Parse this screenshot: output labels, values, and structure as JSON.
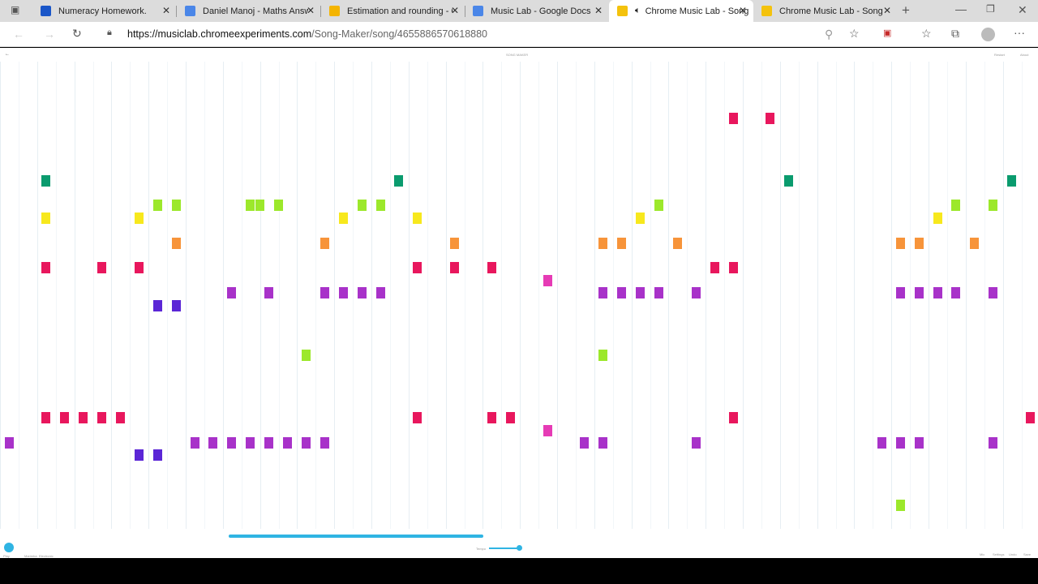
{
  "browser": {
    "tabs": [
      {
        "label": "Numeracy Homework.",
        "color": "#1a56c8"
      },
      {
        "label": "Daniel Manoj - Maths Answ",
        "color": "#4a86e8"
      },
      {
        "label": "Estimation and rounding - G",
        "color": "#f4b400"
      },
      {
        "label": "Music Lab - Google Docs",
        "color": "#4a86e8"
      },
      {
        "label": "Chrome Music Lab - Song Maker",
        "color": "#f4c20d",
        "active": true,
        "audio": true
      },
      {
        "label": "Chrome Music Lab - Song Maker",
        "color": "#f4c20d"
      }
    ],
    "url_domain": "https://musiclab.chromeexperiments.com",
    "url_path": "/Song-Maker/song/4655886570618880"
  },
  "app": {
    "title": "SONG MAKER",
    "top_right": [
      "Restart",
      "About"
    ],
    "bottom_left": [
      "Play",
      "Marimba",
      "Electronic"
    ],
    "tempo_label": "Tempo",
    "tempo_level": 0.9,
    "playback_progress": 0.25,
    "bottom_right": [
      "Mic",
      "Settings",
      "Undo",
      "Save"
    ],
    "accent": "#2fb4e3"
  },
  "song": {
    "row_colors": {
      "4": "#e8175d",
      "9": "#0a9b6e",
      "11": "#9ce82b",
      "12": "#f7e81d",
      "14": "#f7943a",
      "16": "#e8175d",
      "17": "#e63bb5",
      "18": "#a832c9",
      "19": "#5b26d6",
      "23": "#9ce82b",
      "28": "#e8175d",
      "29": "#e63bb5",
      "30": "#a832c9",
      "31": "#5b26d6",
      "35": "#9ce82b"
    },
    "notes": [
      [
        39,
        4
      ],
      [
        41,
        4
      ],
      [
        2,
        9
      ],
      [
        21,
        9
      ],
      [
        42,
        9
      ],
      [
        54,
        9
      ],
      [
        8,
        11
      ],
      [
        9,
        11
      ],
      [
        13,
        11
      ],
      [
        13.5,
        11
      ],
      [
        14.5,
        11
      ],
      [
        19,
        11
      ],
      [
        20,
        11
      ],
      [
        35,
        11
      ],
      [
        51,
        11
      ],
      [
        53,
        11
      ],
      [
        2,
        12
      ],
      [
        7,
        12
      ],
      [
        18,
        12
      ],
      [
        22,
        12
      ],
      [
        34,
        12
      ],
      [
        50,
        12
      ],
      [
        9,
        14
      ],
      [
        17,
        14
      ],
      [
        24,
        14
      ],
      [
        32,
        14
      ],
      [
        33,
        14
      ],
      [
        36,
        14
      ],
      [
        48,
        14
      ],
      [
        49,
        14
      ],
      [
        52,
        14
      ],
      [
        2,
        16
      ],
      [
        5,
        16
      ],
      [
        7,
        16
      ],
      [
        22,
        16
      ],
      [
        24,
        16
      ],
      [
        26,
        16
      ],
      [
        38,
        16
      ],
      [
        39,
        16
      ],
      [
        29,
        17
      ],
      [
        12,
        18
      ],
      [
        14,
        18
      ],
      [
        17,
        18
      ],
      [
        18,
        18
      ],
      [
        19,
        18
      ],
      [
        20,
        18
      ],
      [
        32,
        18
      ],
      [
        33,
        18
      ],
      [
        34,
        18
      ],
      [
        35,
        18
      ],
      [
        37,
        18
      ],
      [
        48,
        18
      ],
      [
        49,
        18
      ],
      [
        50,
        18
      ],
      [
        51,
        18
      ],
      [
        53,
        18
      ],
      [
        8,
        19
      ],
      [
        9,
        19
      ],
      [
        16,
        23
      ],
      [
        32,
        23
      ],
      [
        2,
        28
      ],
      [
        3,
        28
      ],
      [
        4,
        28
      ],
      [
        5,
        28
      ],
      [
        6,
        28
      ],
      [
        22,
        28
      ],
      [
        26,
        28
      ],
      [
        27,
        28
      ],
      [
        39,
        28
      ],
      [
        55,
        28
      ],
      [
        29,
        29
      ],
      [
        0,
        30
      ],
      [
        10,
        30
      ],
      [
        11,
        30
      ],
      [
        12,
        30
      ],
      [
        13,
        30
      ],
      [
        14,
        30
      ],
      [
        15,
        30
      ],
      [
        16,
        30
      ],
      [
        17,
        30
      ],
      [
        31,
        30
      ],
      [
        32,
        30
      ],
      [
        37,
        30
      ],
      [
        47,
        30
      ],
      [
        48,
        30
      ],
      [
        49,
        30
      ],
      [
        53,
        30
      ],
      [
        7,
        31
      ],
      [
        8,
        31
      ],
      [
        48,
        35
      ]
    ]
  }
}
